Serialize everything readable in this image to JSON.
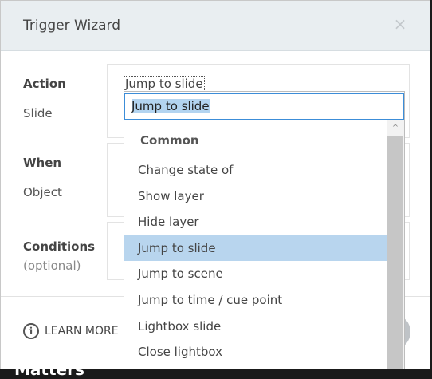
{
  "backdrop": {
    "text": "Matters"
  },
  "dialog": {
    "title": "Trigger Wizard",
    "close_glyph": "×"
  },
  "action": {
    "label": "Action",
    "current_value": "Jump to slide"
  },
  "slide": {
    "label": "Slide"
  },
  "when": {
    "label": "When"
  },
  "object": {
    "label": "Object"
  },
  "conditions": {
    "label": "Conditions",
    "hint": "(optional)"
  },
  "footer": {
    "learn_more": "LEARN MORE",
    "info_icon": "info-circle-icon",
    "info_glyph": "i"
  },
  "dropdown": {
    "search_value": "Jump to slide",
    "group_header": "Common",
    "options": [
      {
        "label": "Change state of",
        "selected": false
      },
      {
        "label": "Show layer",
        "selected": false
      },
      {
        "label": "Hide layer",
        "selected": false
      },
      {
        "label": "Jump to slide",
        "selected": true
      },
      {
        "label": "Jump to scene",
        "selected": false
      },
      {
        "label": "Jump to time / cue point",
        "selected": false
      },
      {
        "label": "Lightbox slide",
        "selected": false
      },
      {
        "label": "Close lightbox",
        "selected": false
      }
    ],
    "scroll_up_glyph": "^"
  },
  "colors": {
    "header_bg": "#e9eef1",
    "selected_bg": "#b8d5ee",
    "input_border": "#3c8dd8",
    "text_highlight": "#b3d4f0"
  }
}
